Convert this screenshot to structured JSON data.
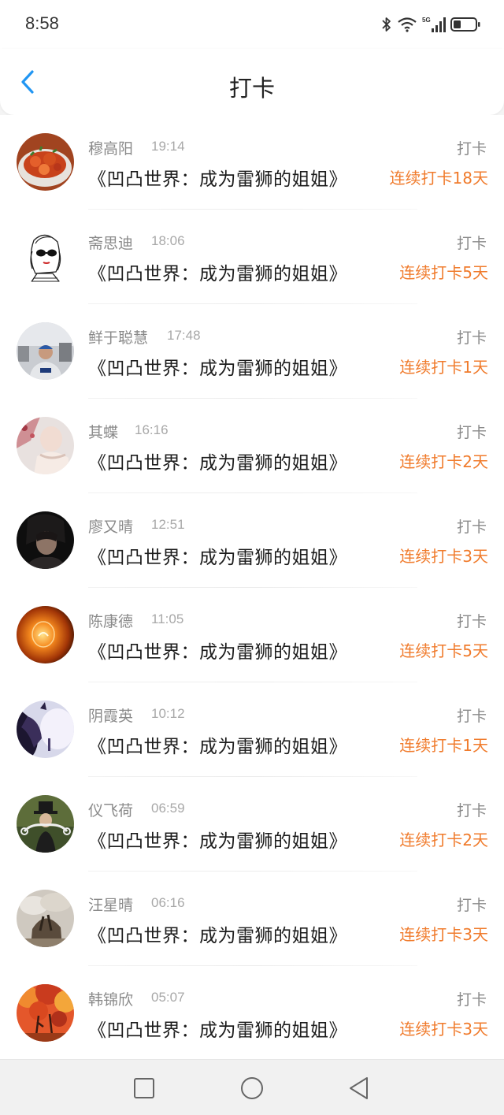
{
  "status_bar": {
    "time": "8:58",
    "icons": [
      "bluetooth-icon",
      "wifi-icon",
      "5g-signal-icon",
      "battery-icon"
    ]
  },
  "header": {
    "title": "打卡",
    "back_icon": "chevron-left-icon"
  },
  "colors": {
    "accent_blue": "#2196f3",
    "streak_orange": "#f07b2c",
    "muted_gray": "#8a8a8a"
  },
  "checkins": [
    {
      "name": "穆高阳",
      "time": "19:14",
      "book": "《凹凸世界：成为雷狮的姐姐》",
      "action": "打卡",
      "streak": "连续打卡18天"
    },
    {
      "name": "斋思迪",
      "time": "18:06",
      "book": "《凹凸世界：成为雷狮的姐姐》",
      "action": "打卡",
      "streak": "连续打卡5天"
    },
    {
      "name": "鲜于聪慧",
      "time": "17:48",
      "book": "《凹凸世界：成为雷狮的姐姐》",
      "action": "打卡",
      "streak": "连续打卡1天"
    },
    {
      "name": "其蝶",
      "time": "16:16",
      "book": "《凹凸世界：成为雷狮的姐姐》",
      "action": "打卡",
      "streak": "连续打卡2天"
    },
    {
      "name": "廖又晴",
      "time": "12:51",
      "book": "《凹凸世界：成为雷狮的姐姐》",
      "action": "打卡",
      "streak": "连续打卡3天"
    },
    {
      "name": "陈康德",
      "time": "11:05",
      "book": "《凹凸世界：成为雷狮的姐姐》",
      "action": "打卡",
      "streak": "连续打卡5天"
    },
    {
      "name": "阴霞英",
      "time": "10:12",
      "book": "《凹凸世界：成为雷狮的姐姐》",
      "action": "打卡",
      "streak": "连续打卡1天"
    },
    {
      "name": "仪飞荷",
      "time": "06:59",
      "book": "《凹凸世界：成为雷狮的姐姐》",
      "action": "打卡",
      "streak": "连续打卡2天"
    },
    {
      "name": "汪星晴",
      "time": "06:16",
      "book": "《凹凸世界：成为雷狮的姐姐》",
      "action": "打卡",
      "streak": "连续打卡3天"
    },
    {
      "name": "韩锦欣",
      "time": "05:07",
      "book": "《凹凸世界：成为雷狮的姐姐》",
      "action": "打卡",
      "streak": "连续打卡3天"
    }
  ],
  "nav_bar": {
    "buttons": [
      "recent-apps-icon",
      "home-icon",
      "back-triangle-icon"
    ]
  }
}
